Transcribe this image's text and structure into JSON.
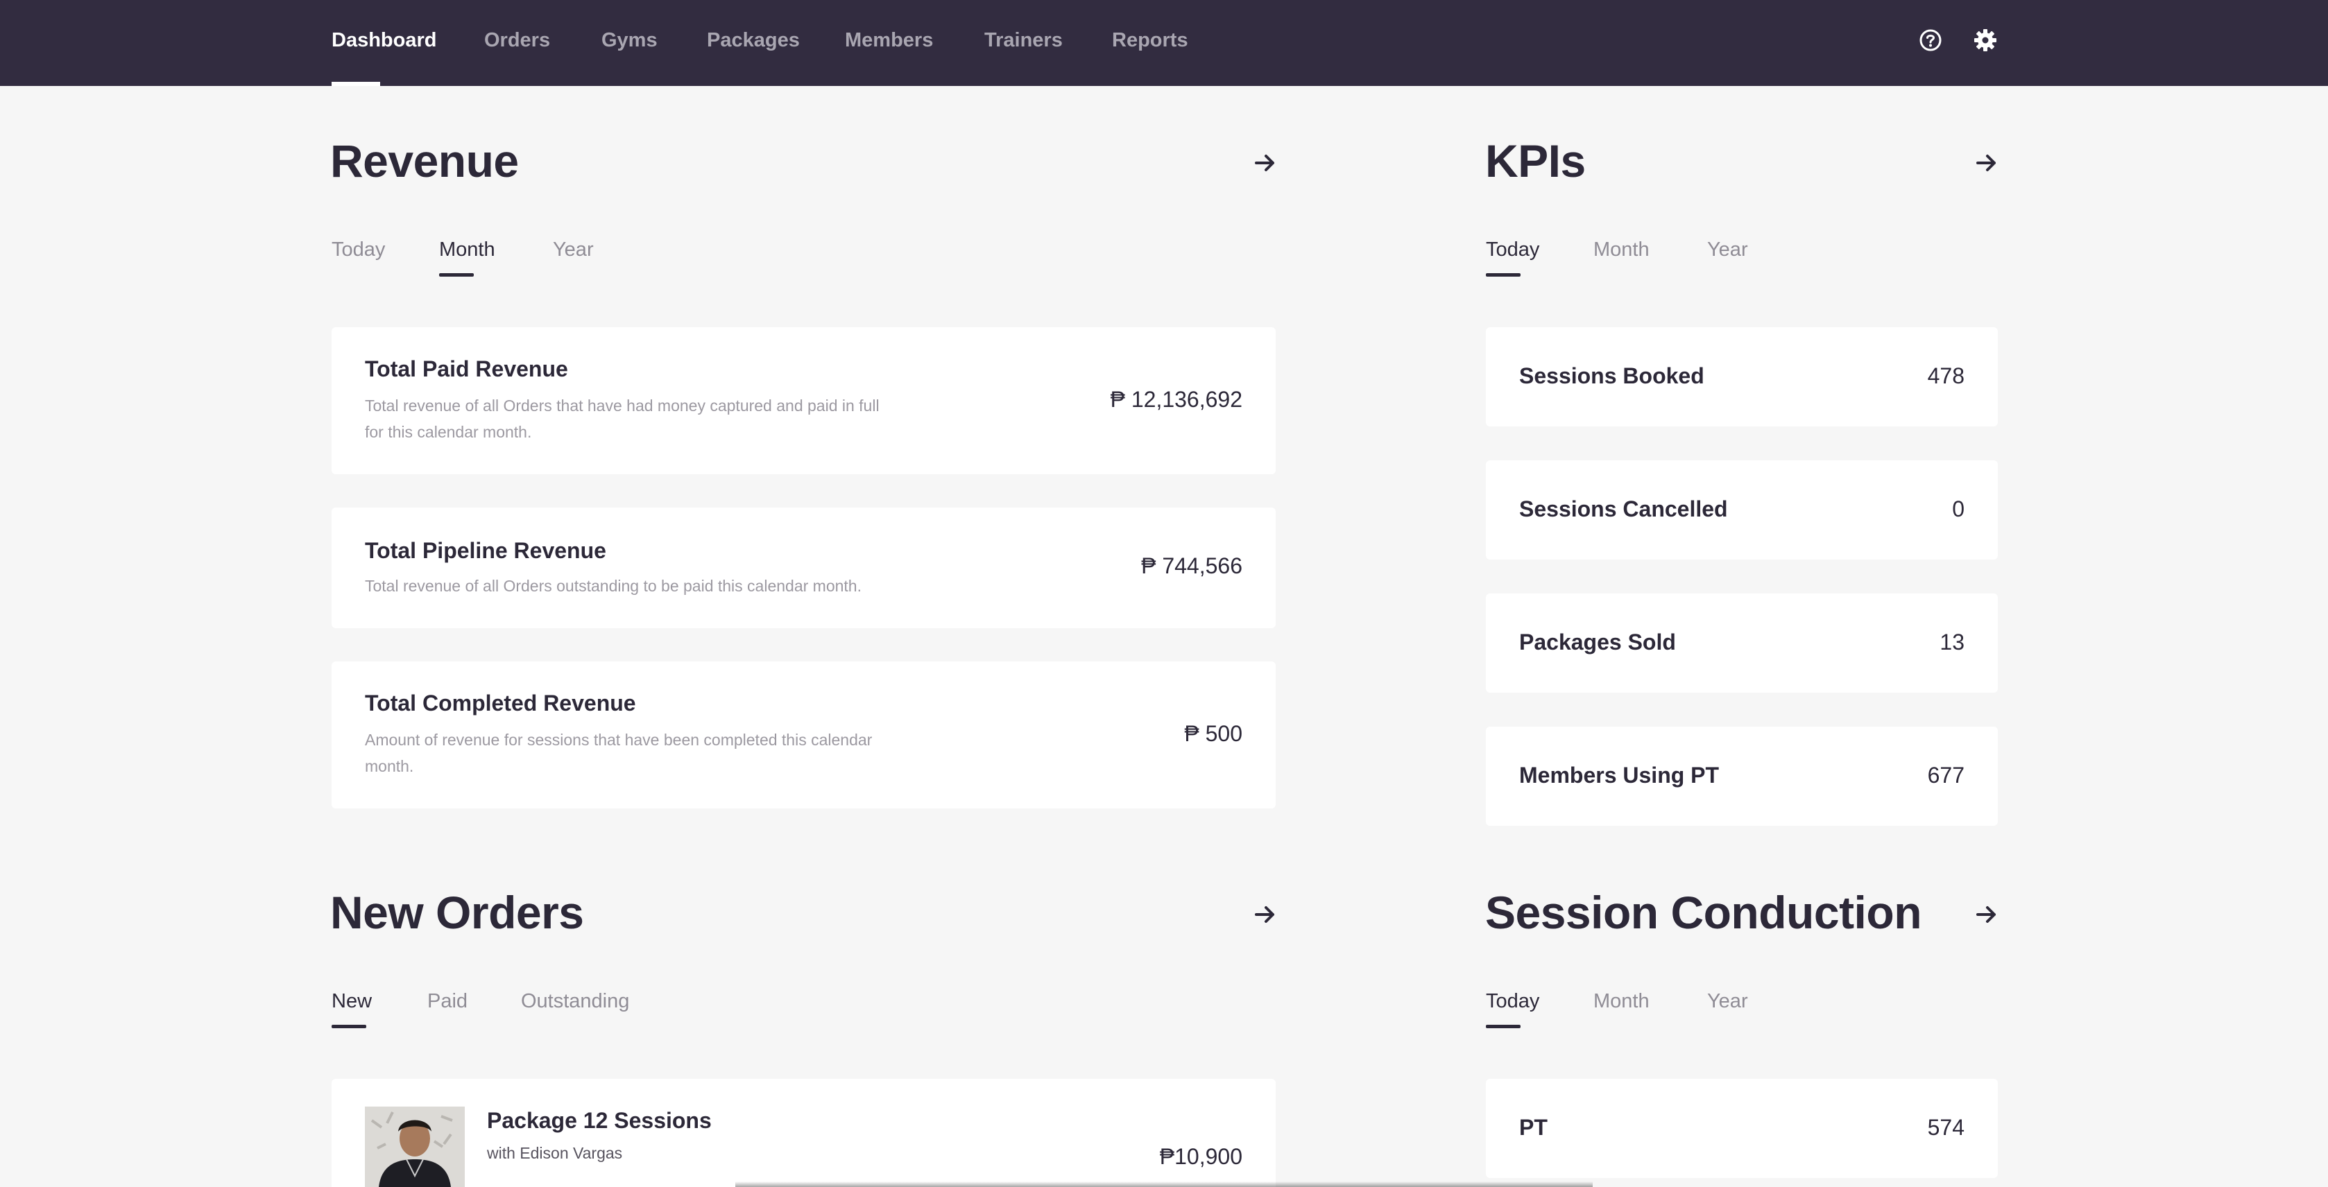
{
  "nav": {
    "items": [
      {
        "label": "Dashboard",
        "active": true
      },
      {
        "label": "Orders"
      },
      {
        "label": "Gyms"
      },
      {
        "label": "Packages"
      },
      {
        "label": "Members"
      },
      {
        "label": "Trainers"
      },
      {
        "label": "Reports"
      }
    ],
    "icons": [
      "help-icon",
      "gear-icon"
    ]
  },
  "revenue": {
    "title": "Revenue",
    "tabs": [
      {
        "label": "Today"
      },
      {
        "label": "Month",
        "active": true
      },
      {
        "label": "Year"
      }
    ],
    "cards": [
      {
        "title": "Total Paid Revenue",
        "description": "Total revenue of all Orders that have had money captured and paid in full for this calendar month.",
        "value": "₱ 12,136,692"
      },
      {
        "title": "Total Pipeline Revenue",
        "description": "Total revenue of all Orders outstanding to be paid this calendar month.",
        "value": "₱ 744,566"
      },
      {
        "title": "Total Completed Revenue",
        "description": "Amount of revenue for sessions that have been completed this calendar month.",
        "value": "₱ 500"
      }
    ]
  },
  "kpis": {
    "title": "KPIs",
    "tabs": [
      {
        "label": "Today",
        "active": true
      },
      {
        "label": "Month"
      },
      {
        "label": "Year"
      }
    ],
    "items": [
      {
        "label": "Sessions Booked",
        "value": "478"
      },
      {
        "label": "Sessions Cancelled",
        "value": "0"
      },
      {
        "label": "Packages Sold",
        "value": "13"
      },
      {
        "label": "Members Using PT",
        "value": "677"
      }
    ]
  },
  "new_orders": {
    "title": "New Orders",
    "tabs": [
      {
        "label": "New",
        "active": true
      },
      {
        "label": "Paid"
      },
      {
        "label": "Outstanding"
      }
    ],
    "orders": [
      {
        "package": "Package 12 Sessions",
        "trainer": "with Edison Vargas",
        "price": "₱10,900"
      }
    ]
  },
  "session_conduction": {
    "title": "Session Conduction",
    "tabs": [
      {
        "label": "Today",
        "active": true
      },
      {
        "label": "Month"
      },
      {
        "label": "Year"
      }
    ],
    "items": [
      {
        "label": "PT",
        "value": "574"
      }
    ]
  },
  "colors": {
    "nav_bg": "#322c40",
    "page_bg": "#f6f6f6",
    "text_dark": "#2c2838",
    "text_muted": "#8f8c95"
  }
}
